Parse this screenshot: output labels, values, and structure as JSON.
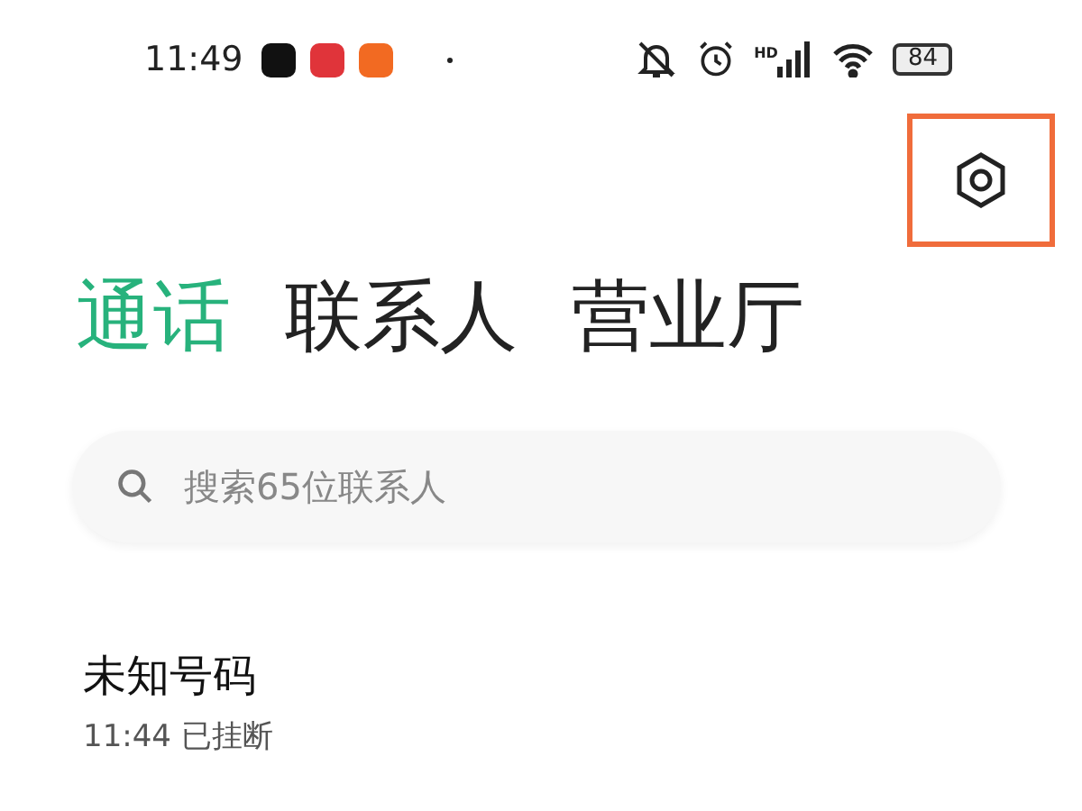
{
  "status_bar": {
    "time": "11:49",
    "network_label": "HD",
    "battery": "84"
  },
  "tabs": [
    {
      "label": "通话",
      "selected": true
    },
    {
      "label": "联系人",
      "selected": false
    },
    {
      "label": "营业厅",
      "selected": false
    }
  ],
  "search": {
    "placeholder": "搜索65位联系人"
  },
  "calls": [
    {
      "name": "未知号码",
      "detail": "11:44 已挂断"
    }
  ]
}
